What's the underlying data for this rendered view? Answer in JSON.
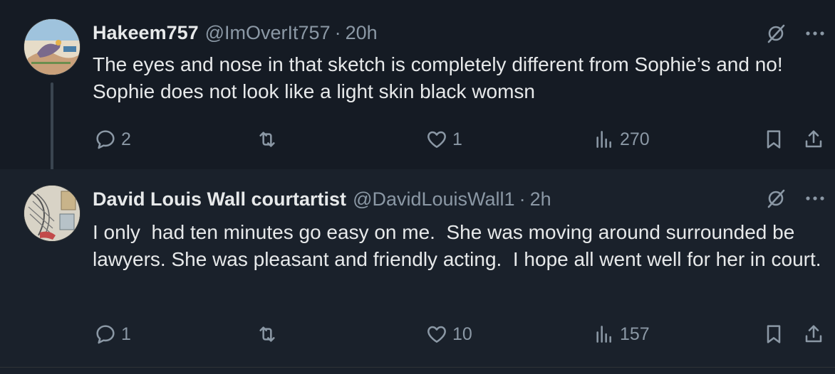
{
  "tweets": [
    {
      "display_name": "Hakeem757",
      "handle": "@ImOverIt757",
      "separator": "·",
      "time": "20h",
      "text": "The eyes and nose in that sketch is completely different from Sophie’s and no! Sophie does not look like a light skin black womsn",
      "actions": {
        "replies": "2",
        "retweets": "",
        "likes": "1",
        "views": "270"
      }
    },
    {
      "display_name": "David Louis Wall courtartist",
      "handle": "@DavidLouisWall1",
      "separator": "·",
      "time": "2h",
      "text": "I only  had ten minutes go easy on me.  She was moving around surrounded be lawyers. She was pleasant and friendly acting.  I hope all went well for her in court.",
      "actions": {
        "replies": "1",
        "retweets": "",
        "likes": "10",
        "views": "157"
      }
    }
  ],
  "icons": {
    "reply": "reply-icon",
    "retweet": "retweet-icon",
    "like": "heart-icon",
    "views": "views-icon",
    "bookmark": "bookmark-icon",
    "share": "share-icon",
    "grok": "grok-icon",
    "more": "more-icon"
  },
  "colors": {
    "background_tweet1": "#151b24",
    "background_tweet2": "#1a212b",
    "text_primary": "#e7e9ea",
    "text_secondary": "#8b98a5",
    "thread_line": "#3a4550"
  }
}
